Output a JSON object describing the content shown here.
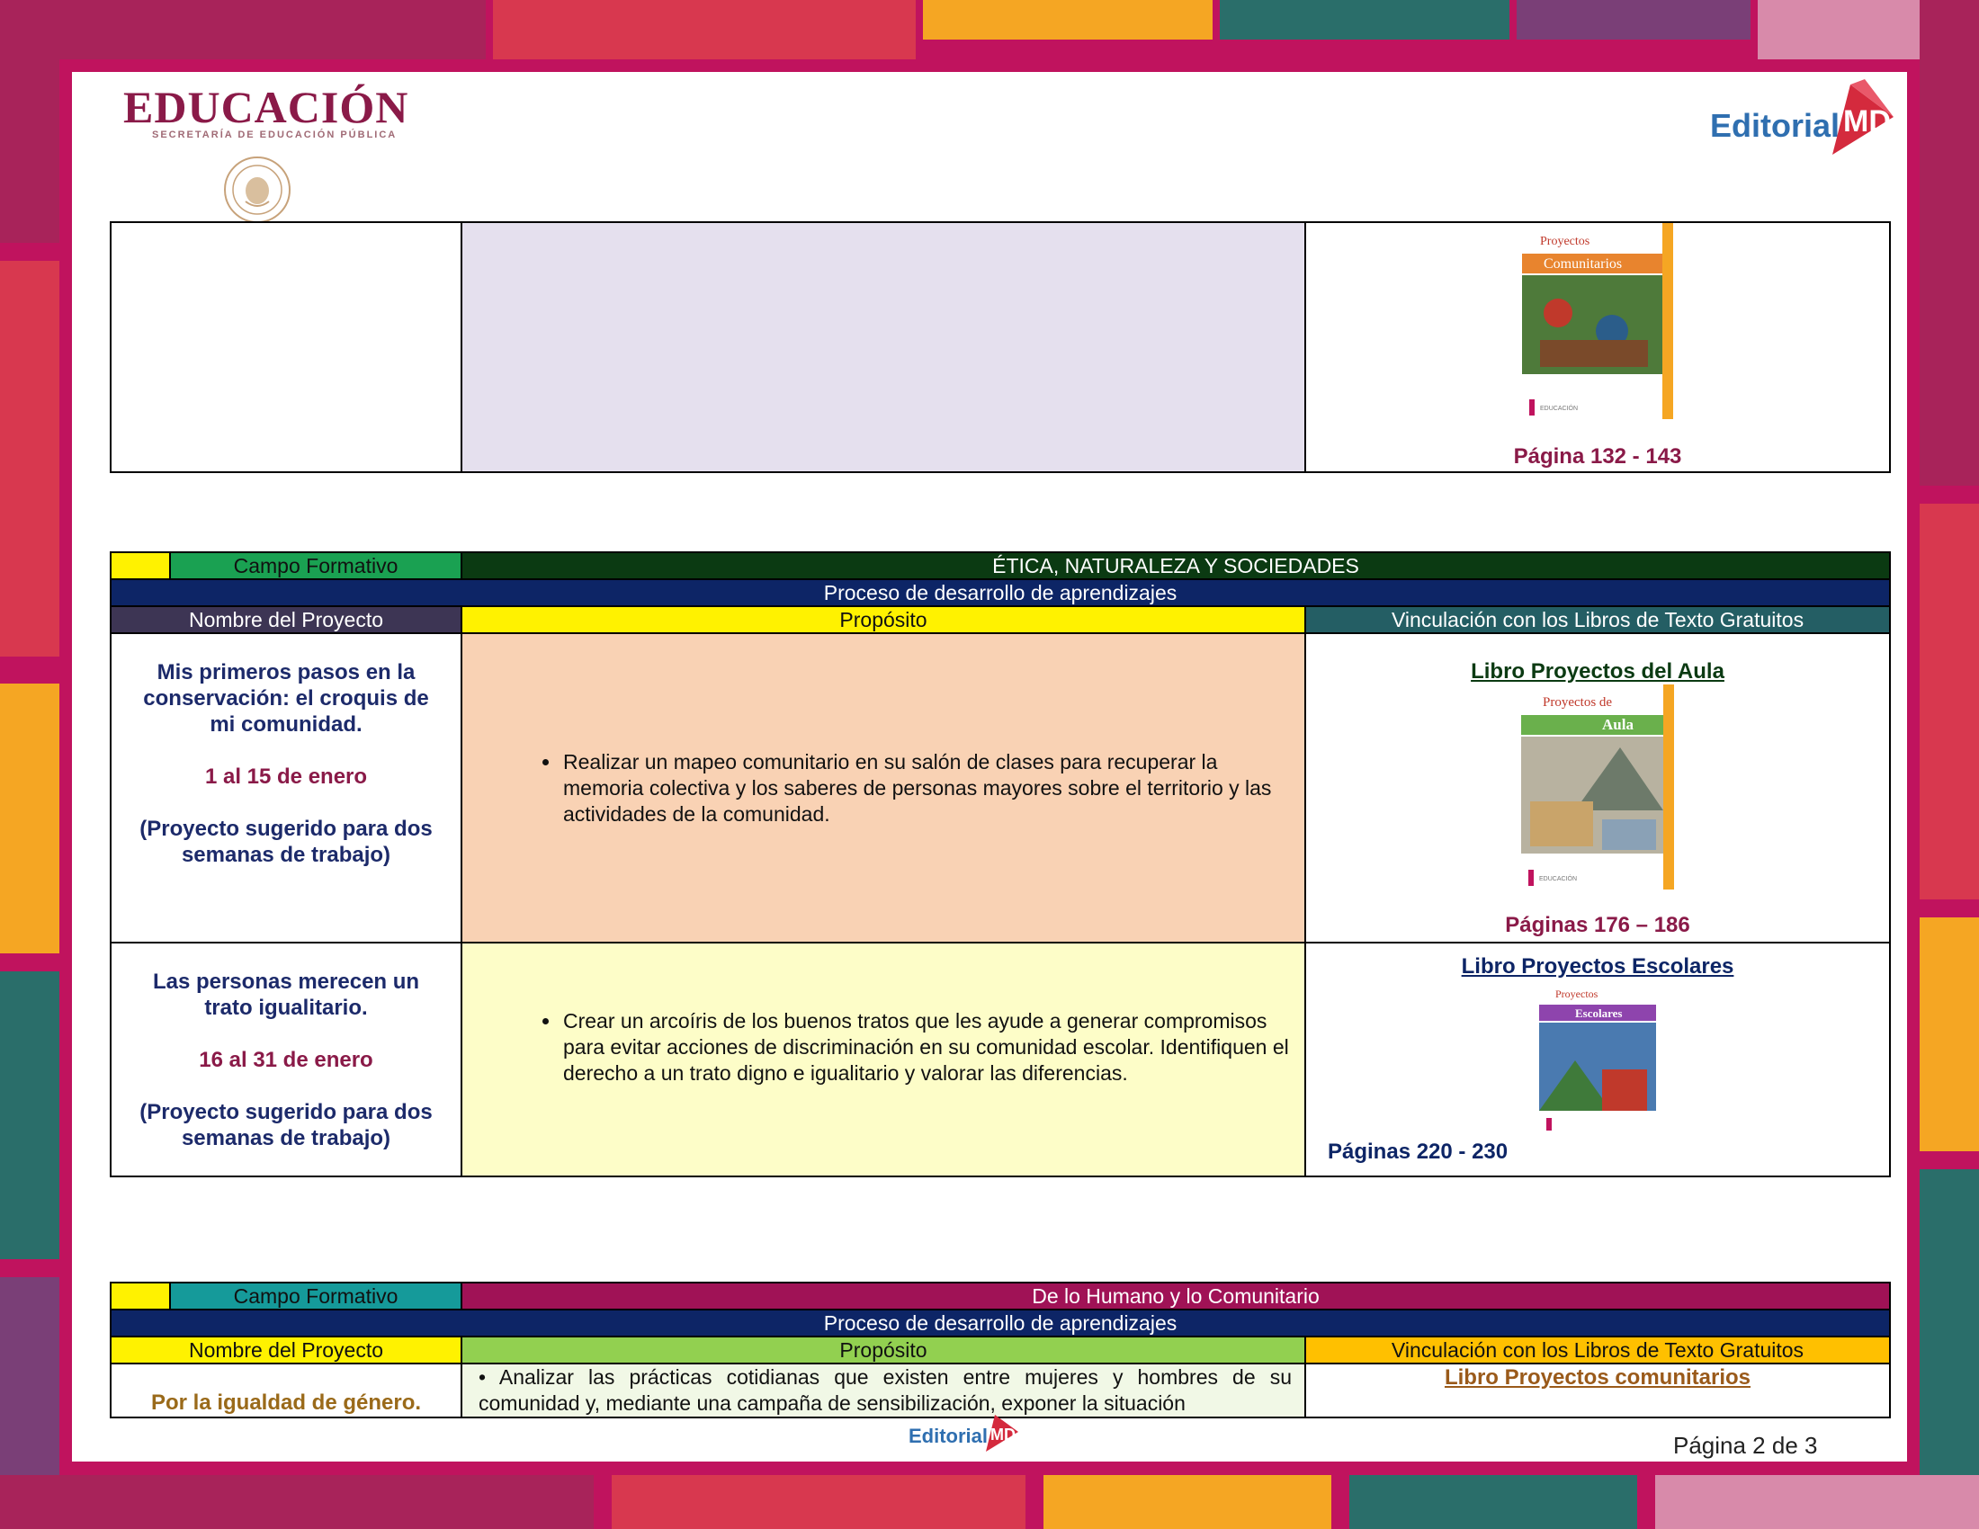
{
  "header": {
    "logo_education": "EDUCACIÓN",
    "logo_education_sub": "SECRETARÍA DE EDUCACIÓN PÚBLICA",
    "logo_editorial": "Editorial",
    "logo_editorial_mark": "MD"
  },
  "colors": {
    "frame": "#c0135e",
    "table1_campo": "#1aa152",
    "table1_campo_name": "#0b3a12",
    "table_process": "#0d2566",
    "table1_col1": "#3d3554",
    "table1_col2": "#fff200",
    "table1_col3": "#245e64",
    "table2_campo": "#159a9a",
    "table2_campo_name": "#a01256",
    "table2_col1": "#fff200",
    "table2_col2": "#92d050",
    "table2_col3": "#ffc000"
  },
  "table0": {
    "page_label": "Página 132 - 143",
    "book_cover": {
      "line1": "Proyectos",
      "line2": "Comunitarios"
    }
  },
  "table1": {
    "campo_label": "Campo Formativo",
    "campo_name": "ÉTICA, NATURALEZA Y SOCIEDADES",
    "process": "Proceso de desarrollo de aprendizajes",
    "col_name": "Nombre del Proyecto",
    "col_purpose": "Propósito",
    "col_link": "Vinculación con los Libros de Texto Gratuitos",
    "rows": [
      {
        "name": "Mis primeros pasos en la conservación: el croquis de mi comunidad.",
        "dates": "1 al 15 de enero",
        "note": "(Proyecto sugerido para dos semanas de trabajo)",
        "purpose": "Realizar un mapeo comunitario en su salón de clases para recuperar la memoria colectiva y los saberes de personas mayores sobre el territorio y las actividades de la comunidad.",
        "book_link": "Libro Proyectos del Aula",
        "book_cover": {
          "line1": "Proyectos de",
          "line2": "Aula"
        },
        "pages": "Páginas 176 – 186"
      },
      {
        "name": "Las personas merecen un trato igualitario.",
        "dates": "16 al 31 de enero",
        "note": "(Proyecto sugerido para dos semanas de trabajo)",
        "purpose": "Crear un arcoíris de los buenos tratos que les ayude a generar compromisos para evitar acciones de discriminación en su comunidad escolar. Identifiquen el derecho a un trato digno e igualitario y valorar las diferencias.",
        "book_link": "Libro Proyectos Escolares",
        "book_cover": {
          "line1": "Proyectos",
          "line2": "Escolares"
        },
        "pages": "Páginas 220 - 230"
      }
    ]
  },
  "table2": {
    "campo_label": "Campo Formativo",
    "campo_name": "De lo Humano y lo Comunitario",
    "process": "Proceso de desarrollo de aprendizajes",
    "col_name": "Nombre del Proyecto",
    "col_purpose": "Propósito",
    "col_link": "Vinculación con los Libros de Texto Gratuitos",
    "row": {
      "name": "Por la igualdad de género.",
      "purpose": "Analizar las prácticas cotidianas que existen entre mujeres y hombres de su comunidad y, mediante una campaña de sensibilización, exponer la situación",
      "book_link": "Libro Proyectos comunitarios"
    }
  },
  "footer": {
    "logo_editorial": "Editorial",
    "logo_editorial_mark": "MD",
    "page_number": "Página 2 de 3"
  }
}
